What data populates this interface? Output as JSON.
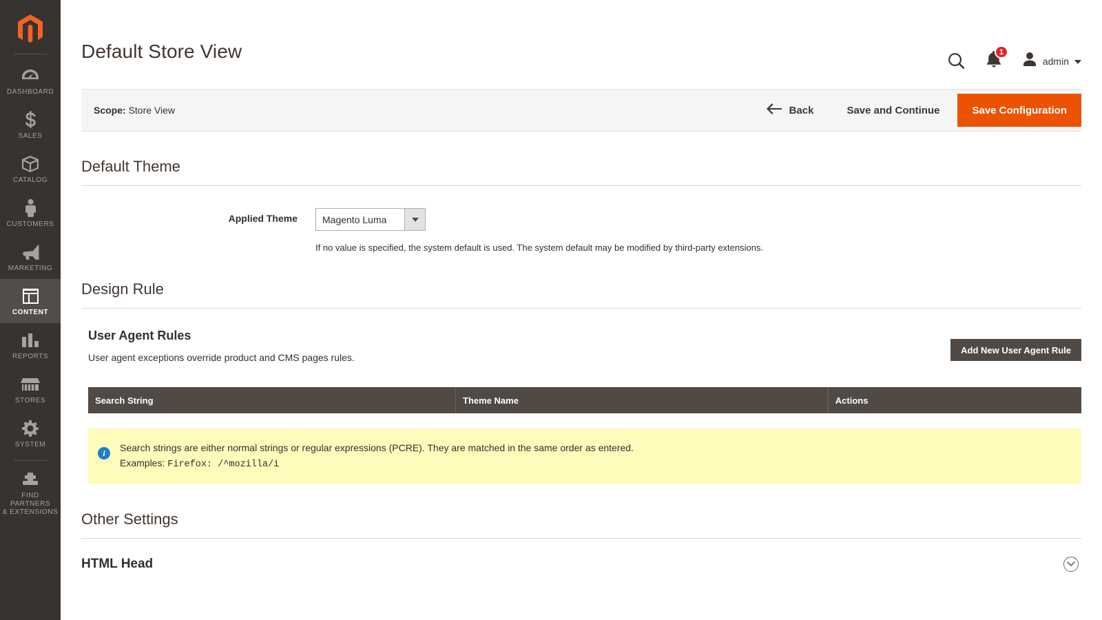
{
  "sidebar": {
    "logo_name": "magento-logo",
    "items": [
      {
        "label": "Dashboard",
        "icon": "dashboard-icon",
        "active": false
      },
      {
        "label": "Sales",
        "icon": "dollar-icon",
        "active": false
      },
      {
        "label": "Catalog",
        "icon": "box-icon",
        "active": false
      },
      {
        "label": "Customers",
        "icon": "person-icon",
        "active": false
      },
      {
        "label": "Marketing",
        "icon": "megaphone-icon",
        "active": false
      },
      {
        "label": "Content",
        "icon": "layout-icon",
        "active": true
      },
      {
        "label": "Reports",
        "icon": "bar-chart-icon",
        "active": false
      },
      {
        "label": "Stores",
        "icon": "storefront-icon",
        "active": false
      },
      {
        "label": "System",
        "icon": "gear-icon",
        "active": false
      },
      {
        "label": "Find Partners\n& Extensions",
        "icon": "puzzle-icon",
        "active": false
      }
    ],
    "find_partners_line1": "FIND PARTNERS",
    "find_partners_line2": "& EXTENSIONS"
  },
  "header": {
    "title": "Default Store View",
    "search_icon": "search-icon",
    "notification_icon": "bell-icon",
    "notification_count": "1",
    "admin_icon": "user-avatar-icon",
    "admin_label": "admin"
  },
  "action_bar": {
    "scope_label": "Scope:",
    "scope_value": "Store View",
    "back_label": "Back",
    "back_icon": "arrow-left-icon",
    "save_continue_label": "Save and Continue",
    "save_config_label": "Save Configuration"
  },
  "default_theme": {
    "section_title": "Default Theme",
    "applied_theme_label": "Applied Theme",
    "applied_theme_value": "Magento Luma",
    "applied_theme_note": "If no value is specified, the system default is used. The system default may be modified by third-party extensions."
  },
  "design_rule": {
    "section_title": "Design Rule",
    "ua_title": "User Agent Rules",
    "ua_description": "User agent exceptions override product and CMS pages rules.",
    "add_rule_label": "Add New User Agent Rule",
    "table": {
      "columns": [
        "Search String",
        "Theme Name",
        "Actions"
      ],
      "rows": []
    },
    "info": {
      "icon": "info-icon",
      "line1": "Search strings are either normal strings or regular expressions (PCRE). They are matched in the same order as entered.",
      "line2_prefix": "Examples:",
      "line2_code": "Firefox: /^mozilla/i"
    }
  },
  "other_settings": {
    "section_title": "Other Settings",
    "html_head_label": "HTML Head",
    "collapse_icon": "chevron-down-circle-icon"
  },
  "colors": {
    "sidebar_bg": "#373330",
    "sidebar_active_bg": "#524d49",
    "brand_orange": "#eb5202",
    "dark_brown": "#514943",
    "badge_red": "#e22626",
    "info_yellow": "#fffbbb",
    "info_blue": "#1e7ec8"
  }
}
